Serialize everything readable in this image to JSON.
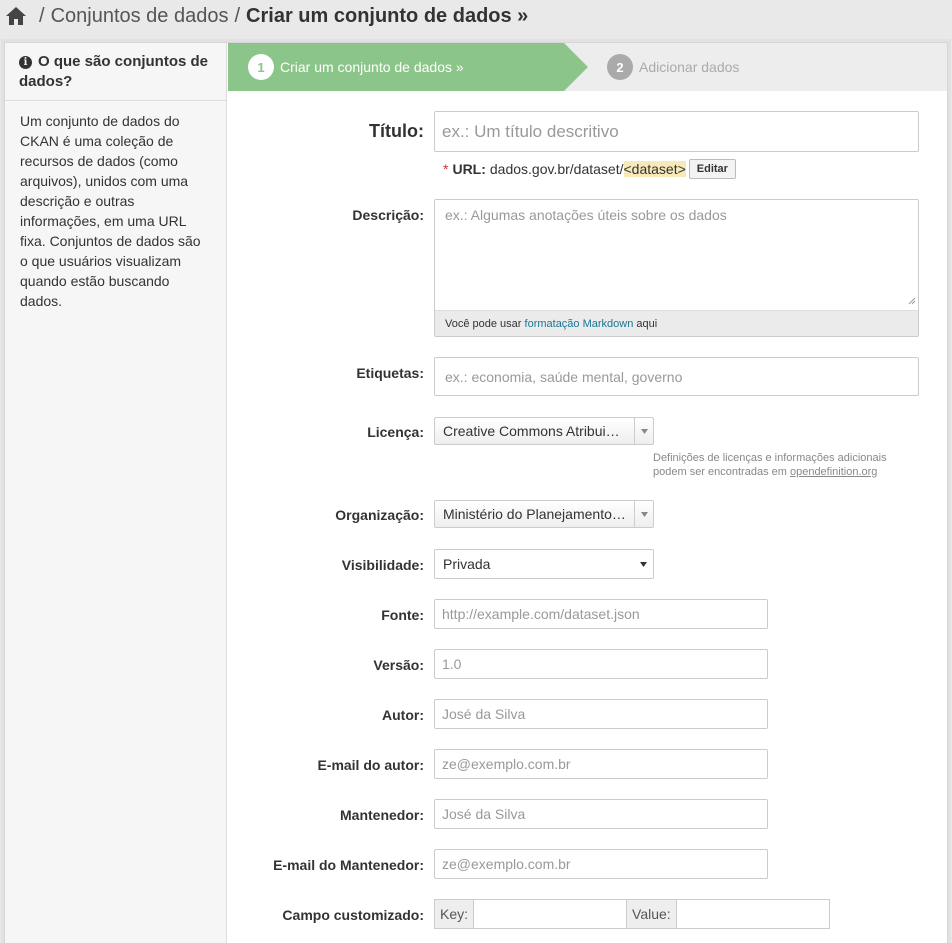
{
  "breadcrumb": {
    "separator": "/",
    "items": [
      "Conjuntos de dados"
    ],
    "current": "Criar um conjunto de dados »"
  },
  "sidebar": {
    "heading": "O que são conjuntos de dados?",
    "body": "Um conjunto de dados do CKAN é uma coleção de recursos de dados (como arquivos), unidos com uma descrição e outras informações, em uma URL fixa. Conjuntos de dados são o que usuários visualizam quando estão buscando dados."
  },
  "stages": [
    {
      "num": "1",
      "label": "Criar um conjunto de dados »"
    },
    {
      "num": "2",
      "label": "Adicionar dados"
    }
  ],
  "form": {
    "title_label": "Título:",
    "title_placeholder": "ex.: Um título descritivo",
    "url_required": "*",
    "url_label": "URL:",
    "url_prefix": "dados.gov.br/dataset/",
    "url_slug": "<dataset>",
    "url_edit": "Editar",
    "desc_label": "Descrição:",
    "desc_placeholder": "ex.: Algumas anotações úteis sobre os dados",
    "markdown_pre": "Você pode usar ",
    "markdown_link": "formatação Markdown",
    "markdown_post": " aqui",
    "tags_label": "Etiquetas:",
    "tags_placeholder": "ex.: economia, saúde mental, governo",
    "license_label": "Licença:",
    "license_value": "Creative Commons Atribui…",
    "license_note": "Definições de licenças e informações adicionais podem ser encontradas em ",
    "license_note_link": "opendefinition.org",
    "org_label": "Organização:",
    "org_value": "Ministério do Planejamento…",
    "vis_label": "Visibilidade:",
    "vis_value": "Privada",
    "source_label": "Fonte:",
    "source_placeholder": "http://example.com/dataset.json",
    "version_label": "Versão:",
    "version_placeholder": "1.0",
    "author_label": "Autor:",
    "author_placeholder": "José da Silva",
    "author_email_label": "E-mail do autor:",
    "author_email_placeholder": "ze@exemplo.com.br",
    "maintainer_label": "Mantenedor:",
    "maintainer_placeholder": "José da Silva",
    "maintainer_email_label": "E-mail do Mantenedor:",
    "maintainer_email_placeholder": "ze@exemplo.com.br",
    "custom_label": "Campo customizado:",
    "custom_key": "Key:",
    "custom_value": "Value:"
  },
  "colors": {
    "accent": "#8cc58a",
    "link": "#187794",
    "slug_bg": "#f7e9b8"
  }
}
